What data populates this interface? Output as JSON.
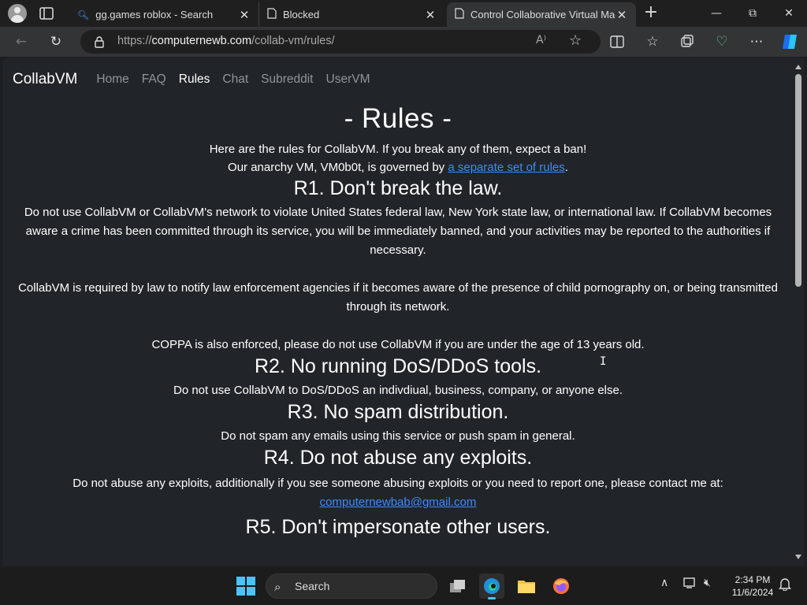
{
  "browser": {
    "tabs": [
      {
        "label": "gg.games roblox - Search",
        "icon": "bing-search-icon"
      },
      {
        "label": "Blocked",
        "icon": "page-icon"
      },
      {
        "label": "Control Collaborative Virtual Mac",
        "icon": "page-icon",
        "active": true
      }
    ],
    "url_prefix": "https://",
    "url_host": "computernewb.com",
    "url_path": "/collab-vm/rules/",
    "read_aloud_label": "A⁾"
  },
  "site": {
    "brand": "CollabVM",
    "nav": [
      "Home",
      "FAQ",
      "Rules",
      "Chat",
      "Subreddit",
      "UserVM"
    ],
    "active_nav": "Rules"
  },
  "page": {
    "title": "- Rules -",
    "intro_line1": "Here are the rules for CollabVM. If you break any of them, expect a ban!",
    "intro_line2_prefix": "Our anarchy VM, VM0b0t, is governed by ",
    "intro_line2_link": "a separate set of rules",
    "intro_line2_suffix": ".",
    "rules": [
      {
        "heading": "R1. Don't break the law.",
        "paragraphs": [
          "Do not use CollabVM or CollabVM's network to violate United States federal law, New York state law, or international law. If CollabVM becomes aware a crime has been committed through its service, you will be immediately banned, and your activities may be reported to the authorities if necessary.",
          "CollabVM is required by law to notify law enforcement agencies if it becomes aware of the presence of child pornography on, or being transmitted through its network.",
          "COPPA is also enforced, please do not use CollabVM if you are under the age of 13 years old."
        ]
      },
      {
        "heading": "R2. No running DoS/DDoS tools.",
        "paragraphs": [
          "Do not use CollabVM to DoS/DDoS an indivdiual, business, company, or anyone else."
        ]
      },
      {
        "heading": "R3. No spam distribution.",
        "paragraphs": [
          "Do not spam any emails using this service or push spam in general."
        ]
      },
      {
        "heading": "R4. Do not abuse any exploits.",
        "paragraphs": [
          "Do not abuse any exploits, additionally if you see someone abusing exploits or you need to report one, please contact me at:"
        ],
        "email": "computernewbab@gmail.com"
      },
      {
        "heading": "R5. Don't impersonate other users."
      }
    ]
  },
  "taskbar": {
    "search_label": "Search",
    "time": "2:34 PM",
    "date": "11/6/2024"
  },
  "colors": {
    "page_bg": "#212529",
    "link": "#3d8bfd",
    "accent": "#4cc2ff"
  }
}
